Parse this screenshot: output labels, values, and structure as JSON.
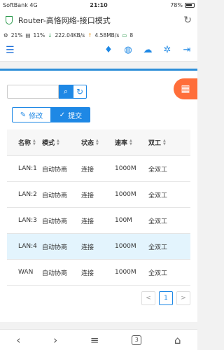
{
  "status": {
    "carrier": "SoftBank 4G",
    "time": "21:10",
    "battery": "78%"
  },
  "browser": {
    "title": "Router-高恪网络-接口模式"
  },
  "net": {
    "cpu": "21%",
    "mem": "11%",
    "down": "222.04KB/s",
    "up": "4.58MB/s",
    "devices": "8"
  },
  "search": {
    "placeholder": ""
  },
  "actions": {
    "edit": "修改",
    "submit": "提交"
  },
  "table": {
    "headers": [
      "名称",
      "模式",
      "状态",
      "速率",
      "双工"
    ],
    "rows": [
      [
        "LAN:1",
        "自动协商",
        "连接",
        "1000M",
        "全双工"
      ],
      [
        "LAN:2",
        "自动协商",
        "连接",
        "1000M",
        "全双工"
      ],
      [
        "LAN:3",
        "自动协商",
        "连接",
        "100M",
        "全双工"
      ],
      [
        "LAN:4",
        "自动协商",
        "连接",
        "1000M",
        "全双工"
      ],
      [
        "WAN",
        "自动协商",
        "连接",
        "1000M",
        "全双工"
      ]
    ]
  },
  "pager": {
    "prev": "<",
    "page": "1",
    "next": ">"
  },
  "colors": {
    "accent": "#1e88e5",
    "fab": "#ff6e3a",
    "highlight": "#e3f4fd"
  }
}
